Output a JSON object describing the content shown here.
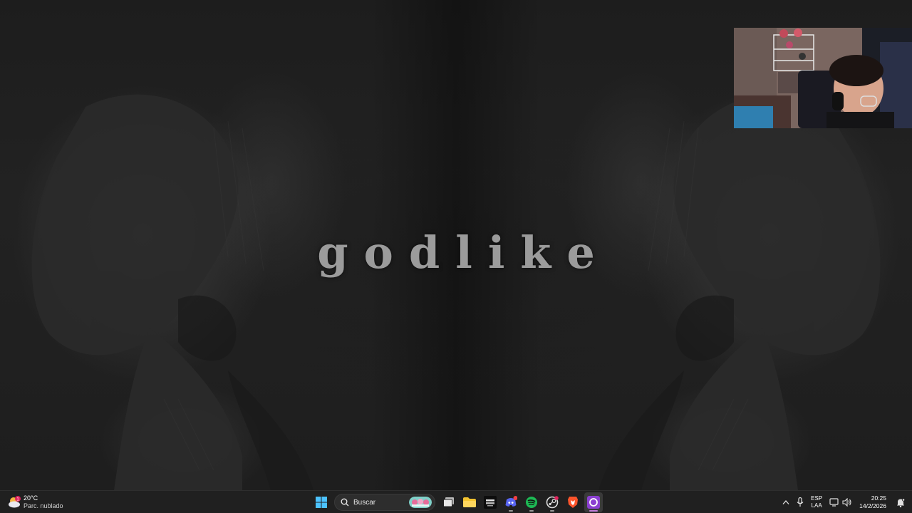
{
  "desktop": {
    "wallpaper_title": "godlike"
  },
  "taskbar": {
    "weather": {
      "temperature": "20°C",
      "description": "Parc. nublado",
      "alert_badge": "1"
    },
    "search": {
      "label": "Buscar"
    },
    "pinned_apps": [
      {
        "name": "start",
        "icon": "windows-logo-icon"
      },
      {
        "name": "task-view",
        "icon": "task-view-icon"
      },
      {
        "name": "file-explorer",
        "icon": "folder-icon"
      },
      {
        "name": "call-of-duty",
        "icon": "cod-icon"
      },
      {
        "name": "discord",
        "icon": "discord-icon"
      },
      {
        "name": "spotify",
        "icon": "spotify-icon"
      },
      {
        "name": "steam",
        "icon": "steam-icon"
      },
      {
        "name": "brave",
        "icon": "brave-lion-icon"
      },
      {
        "name": "obs-like-app",
        "icon": "purple-ring-icon"
      }
    ],
    "tray": {
      "language_top": "ESP",
      "language_bottom": "LAA",
      "time": "20:25",
      "date": "14/2/2026"
    }
  },
  "colors": {
    "taskbar_bg": "#202020",
    "accent_purple": "#c07bd8",
    "spotify_green": "#1db954",
    "discord_blurple": "#5865f2",
    "brave_orange": "#fb542b",
    "folder_yellow": "#f4c430"
  }
}
